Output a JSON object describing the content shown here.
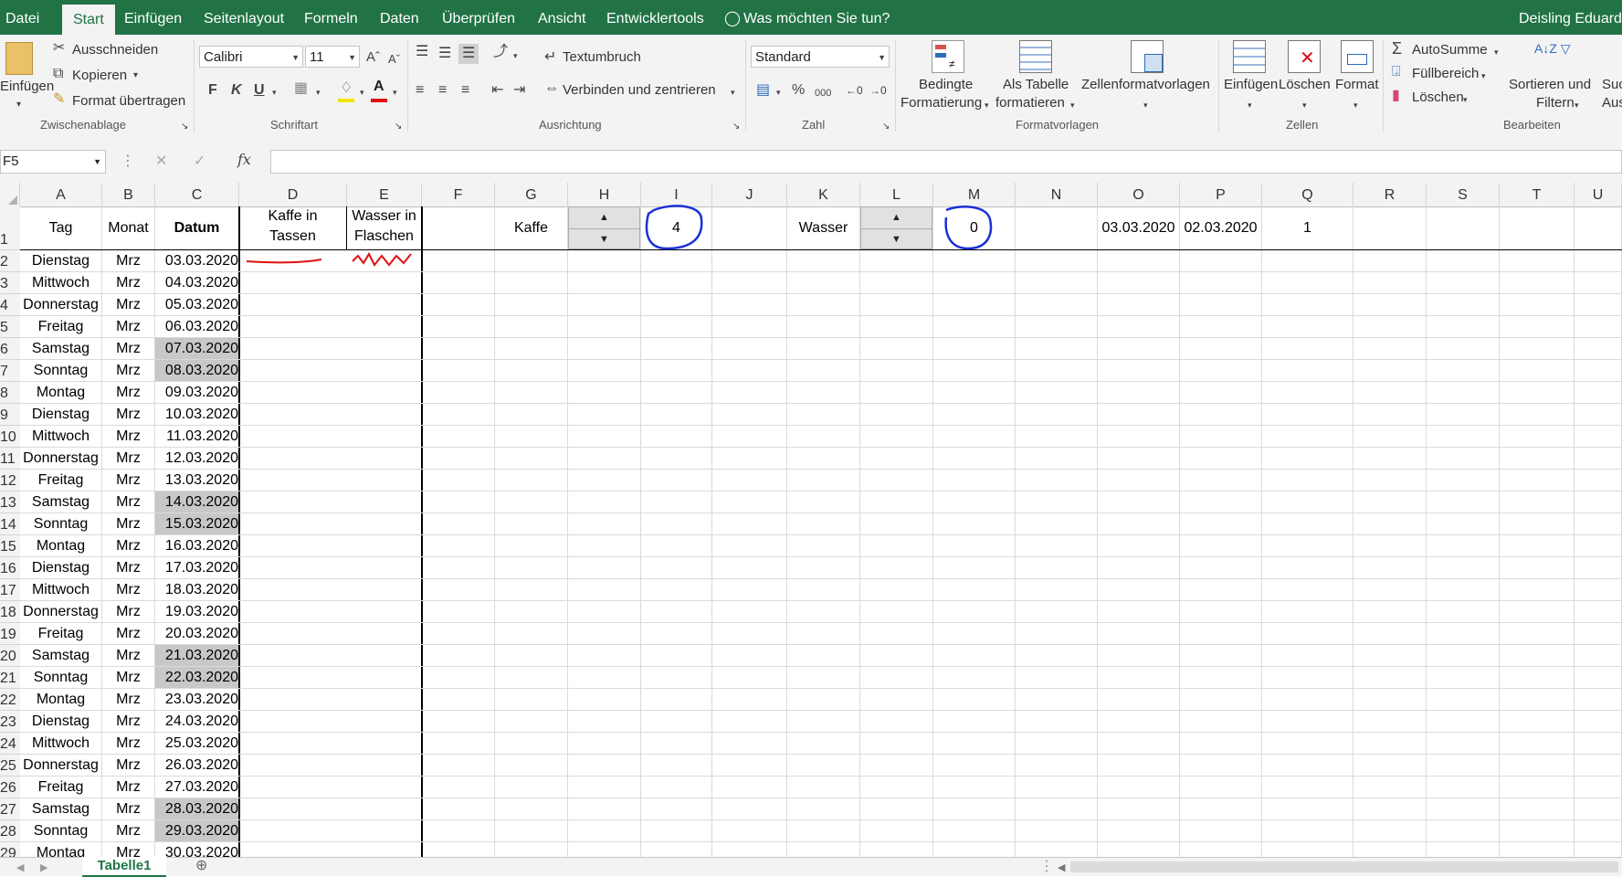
{
  "menu": {
    "items": [
      "Datei",
      "Start",
      "Einfügen",
      "Seitenlayout",
      "Formeln",
      "Daten",
      "Überprüfen",
      "Ansicht",
      "Entwicklertools"
    ],
    "tell_me": "Was möchten Sie tun?",
    "user": "Deisling Eduard"
  },
  "ribbon": {
    "clipboard": {
      "paste": "Einfügen",
      "cut": "Ausschneiden",
      "copy": "Kopieren",
      "format_painter": "Format übertragen",
      "title": "Zwischenablage"
    },
    "font": {
      "name": "Calibri",
      "size": "11",
      "bold": "F",
      "italic": "K",
      "underline": "U",
      "title": "Schriftart"
    },
    "alignment": {
      "wrap": "Textumbruch",
      "merge": "Verbinden und zentrieren",
      "title": "Ausrichtung"
    },
    "number": {
      "format": "Standard",
      "percent": "%",
      "thousands": "000",
      "title": "Zahl"
    },
    "styles": {
      "conditional_1": "Bedingte",
      "conditional_2": "Formatierung",
      "table_1": "Als Tabelle",
      "table_2": "formatieren",
      "cell_styles": "Zellenformatvorlagen",
      "title": "Formatvorlagen"
    },
    "cells": {
      "insert": "Einfügen",
      "delete": "Löschen",
      "format": "Format",
      "title": "Zellen"
    },
    "editing": {
      "autosum": "AutoSumme",
      "fill": "Füllbereich",
      "clear": "Löschen",
      "sort_1": "Sortieren und",
      "sort_2": "Filtern",
      "find_1": "Suc",
      "find_2": "Ausv",
      "title": "Bearbeiten"
    }
  },
  "formula_bar": {
    "name_box": "F5",
    "fx": "fx",
    "formula": ""
  },
  "columns": [
    "A",
    "B",
    "C",
    "D",
    "E",
    "F",
    "G",
    "H",
    "I",
    "J",
    "K",
    "L",
    "M",
    "N",
    "O",
    "P",
    "Q",
    "R",
    "S",
    "T",
    "U"
  ],
  "header_row": {
    "A": "Tag",
    "B": "Monat",
    "C": "Datum",
    "D1": "Kaffe in",
    "D2": "Tassen",
    "E1": "Wasser in",
    "E2": "Flaschen",
    "G": "Kaffe",
    "I": "4",
    "K": "Wasser",
    "M": "0",
    "O": "03.03.2020",
    "P": "02.03.2020",
    "Q": "1"
  },
  "rows": [
    {
      "n": "2",
      "tag": "Dienstag",
      "monat": "Mrz",
      "datum": "03.03.2020",
      "weekend": false
    },
    {
      "n": "3",
      "tag": "Mittwoch",
      "monat": "Mrz",
      "datum": "04.03.2020",
      "weekend": false
    },
    {
      "n": "4",
      "tag": "Donnerstag",
      "monat": "Mrz",
      "datum": "05.03.2020",
      "weekend": false
    },
    {
      "n": "5",
      "tag": "Freitag",
      "monat": "Mrz",
      "datum": "06.03.2020",
      "weekend": false
    },
    {
      "n": "6",
      "tag": "Samstag",
      "monat": "Mrz",
      "datum": "07.03.2020",
      "weekend": true
    },
    {
      "n": "7",
      "tag": "Sonntag",
      "monat": "Mrz",
      "datum": "08.03.2020",
      "weekend": true
    },
    {
      "n": "8",
      "tag": "Montag",
      "monat": "Mrz",
      "datum": "09.03.2020",
      "weekend": false
    },
    {
      "n": "9",
      "tag": "Dienstag",
      "monat": "Mrz",
      "datum": "10.03.2020",
      "weekend": false
    },
    {
      "n": "10",
      "tag": "Mittwoch",
      "monat": "Mrz",
      "datum": "11.03.2020",
      "weekend": false
    },
    {
      "n": "11",
      "tag": "Donnerstag",
      "monat": "Mrz",
      "datum": "12.03.2020",
      "weekend": false
    },
    {
      "n": "12",
      "tag": "Freitag",
      "monat": "Mrz",
      "datum": "13.03.2020",
      "weekend": false
    },
    {
      "n": "13",
      "tag": "Samstag",
      "monat": "Mrz",
      "datum": "14.03.2020",
      "weekend": true
    },
    {
      "n": "14",
      "tag": "Sonntag",
      "monat": "Mrz",
      "datum": "15.03.2020",
      "weekend": true
    },
    {
      "n": "15",
      "tag": "Montag",
      "monat": "Mrz",
      "datum": "16.03.2020",
      "weekend": false
    },
    {
      "n": "16",
      "tag": "Dienstag",
      "monat": "Mrz",
      "datum": "17.03.2020",
      "weekend": false
    },
    {
      "n": "17",
      "tag": "Mittwoch",
      "monat": "Mrz",
      "datum": "18.03.2020",
      "weekend": false
    },
    {
      "n": "18",
      "tag": "Donnerstag",
      "monat": "Mrz",
      "datum": "19.03.2020",
      "weekend": false
    },
    {
      "n": "19",
      "tag": "Freitag",
      "monat": "Mrz",
      "datum": "20.03.2020",
      "weekend": false
    },
    {
      "n": "20",
      "tag": "Samstag",
      "monat": "Mrz",
      "datum": "21.03.2020",
      "weekend": true
    },
    {
      "n": "21",
      "tag": "Sonntag",
      "monat": "Mrz",
      "datum": "22.03.2020",
      "weekend": true
    },
    {
      "n": "22",
      "tag": "Montag",
      "monat": "Mrz",
      "datum": "23.03.2020",
      "weekend": false
    },
    {
      "n": "23",
      "tag": "Dienstag",
      "monat": "Mrz",
      "datum": "24.03.2020",
      "weekend": false
    },
    {
      "n": "24",
      "tag": "Mittwoch",
      "monat": "Mrz",
      "datum": "25.03.2020",
      "weekend": false
    },
    {
      "n": "25",
      "tag": "Donnerstag",
      "monat": "Mrz",
      "datum": "26.03.2020",
      "weekend": false
    },
    {
      "n": "26",
      "tag": "Freitag",
      "monat": "Mrz",
      "datum": "27.03.2020",
      "weekend": false
    },
    {
      "n": "27",
      "tag": "Samstag",
      "monat": "Mrz",
      "datum": "28.03.2020",
      "weekend": true
    },
    {
      "n": "28",
      "tag": "Sonntag",
      "monat": "Mrz",
      "datum": "29.03.2020",
      "weekend": true
    },
    {
      "n": "29",
      "tag": "Montag",
      "monat": "Mrz",
      "datum": "30.03.2020",
      "weekend": false
    }
  ],
  "row1_label": "1",
  "sheet_tab": "Tabelle1",
  "colors": {
    "excel_green": "#217346",
    "weekend_fill": "#c8c8c8",
    "annotation_blue": "#1a2fd6",
    "annotation_red": "#e01010"
  }
}
